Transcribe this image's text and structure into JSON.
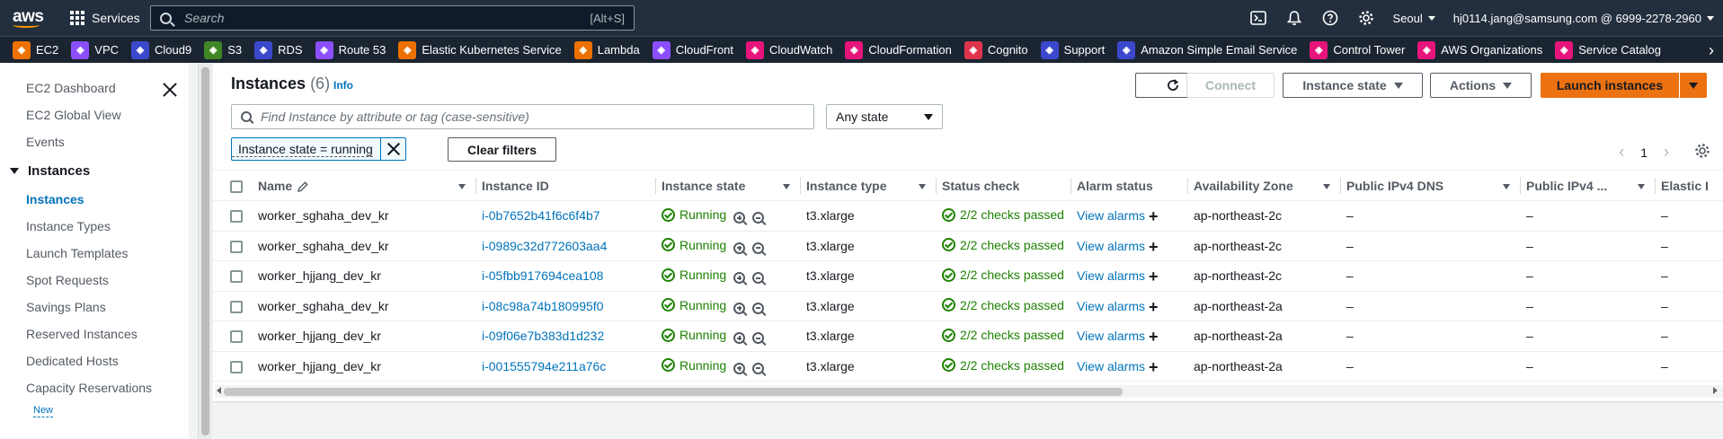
{
  "topnav": {
    "logo_text": "aws",
    "services_label": "Services",
    "search_placeholder": "Search",
    "search_shortcut": "[Alt+S]",
    "region": "Seoul",
    "account": "hj0114.jang@samsung.com @ 6999-2278-2960"
  },
  "favorites": [
    {
      "label": "EC2",
      "color": "#ed7100"
    },
    {
      "label": "VPC",
      "color": "#8c4fff"
    },
    {
      "label": "Cloud9",
      "color": "#3b48cc"
    },
    {
      "label": "S3",
      "color": "#3f8624"
    },
    {
      "label": "RDS",
      "color": "#3b48cc"
    },
    {
      "label": "Route 53",
      "color": "#8c4fff"
    },
    {
      "label": "Elastic Kubernetes Service",
      "color": "#ed7100"
    },
    {
      "label": "Lambda",
      "color": "#ed7100"
    },
    {
      "label": "CloudFront",
      "color": "#8c4fff"
    },
    {
      "label": "CloudWatch",
      "color": "#e7157b"
    },
    {
      "label": "CloudFormation",
      "color": "#e7157b"
    },
    {
      "label": "Cognito",
      "color": "#dd344c"
    },
    {
      "label": "Support",
      "color": "#3b48cc"
    },
    {
      "label": "Amazon Simple Email Service",
      "color": "#3b48cc"
    },
    {
      "label": "Control Tower",
      "color": "#e7157b"
    },
    {
      "label": "AWS Organizations",
      "color": "#e7157b"
    },
    {
      "label": "Service Catalog",
      "color": "#e7157b"
    }
  ],
  "sidebar": {
    "top_items": [
      "EC2 Dashboard",
      "EC2 Global View",
      "Events"
    ],
    "section": "Instances",
    "items": [
      "Instances",
      "Instance Types",
      "Launch Templates",
      "Spot Requests",
      "Savings Plans",
      "Reserved Instances",
      "Dedicated Hosts",
      "Capacity Reservations"
    ],
    "new_badge": "New"
  },
  "main": {
    "title": "Instances",
    "count": "(6)",
    "info": "Info",
    "connect": "Connect",
    "instance_state": "Instance state",
    "actions": "Actions",
    "launch": "Launch instances",
    "find_placeholder": "Find Instance by attribute or tag (case-sensitive)",
    "any_state": "Any state",
    "filter_token": "Instance state = running",
    "clear_filters": "Clear filters",
    "page": "1"
  },
  "table": {
    "columns": [
      "Name",
      "Instance ID",
      "Instance state",
      "Instance type",
      "Status check",
      "Alarm status",
      "Availability Zone",
      "Public IPv4 DNS",
      "Public IPv4 ...",
      "Elastic I"
    ],
    "rows": [
      {
        "name": "worker_sghaha_dev_kr",
        "id": "i-0b7652b41f6c6f4b7",
        "state": "Running",
        "type": "t3.xlarge",
        "status": "2/2 checks passed",
        "alarm": "View alarms",
        "az": "ap-northeast-2c",
        "dns": "–",
        "ipv4": "–",
        "eip": "–"
      },
      {
        "name": "worker_sghaha_dev_kr",
        "id": "i-0989c32d772603aa4",
        "state": "Running",
        "type": "t3.xlarge",
        "status": "2/2 checks passed",
        "alarm": "View alarms",
        "az": "ap-northeast-2c",
        "dns": "–",
        "ipv4": "–",
        "eip": "–"
      },
      {
        "name": "worker_hjjang_dev_kr",
        "id": "i-05fbb917694cea108",
        "state": "Running",
        "type": "t3.xlarge",
        "status": "2/2 checks passed",
        "alarm": "View alarms",
        "az": "ap-northeast-2c",
        "dns": "–",
        "ipv4": "–",
        "eip": "–"
      },
      {
        "name": "worker_sghaha_dev_kr",
        "id": "i-08c98a74b180995f0",
        "state": "Running",
        "type": "t3.xlarge",
        "status": "2/2 checks passed",
        "alarm": "View alarms",
        "az": "ap-northeast-2a",
        "dns": "–",
        "ipv4": "–",
        "eip": "–"
      },
      {
        "name": "worker_hjjang_dev_kr",
        "id": "i-09f06e7b383d1d232",
        "state": "Running",
        "type": "t3.xlarge",
        "status": "2/2 checks passed",
        "alarm": "View alarms",
        "az": "ap-northeast-2a",
        "dns": "–",
        "ipv4": "–",
        "eip": "–"
      },
      {
        "name": "worker_hjjang_dev_kr",
        "id": "i-001555794e211a76c",
        "state": "Running",
        "type": "t3.xlarge",
        "status": "2/2 checks passed",
        "alarm": "View alarms",
        "az": "ap-northeast-2a",
        "dns": "–",
        "ipv4": "–",
        "eip": "–"
      }
    ]
  }
}
